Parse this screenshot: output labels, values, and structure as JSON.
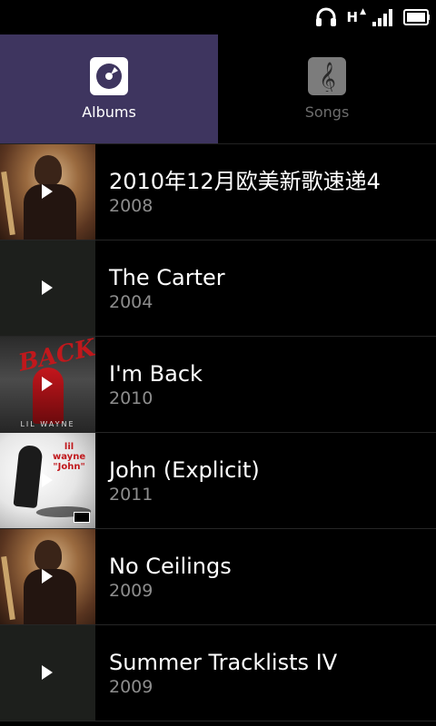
{
  "status_bar": {
    "network_type": "H",
    "icons": [
      "headphones-icon",
      "network-type-icon",
      "signal-icon",
      "battery-icon"
    ]
  },
  "tabs": [
    {
      "label": "Albums",
      "icon": "album-disc-icon",
      "active": true
    },
    {
      "label": "Songs",
      "icon": "music-note-icon",
      "active": false
    }
  ],
  "albums": [
    {
      "title": "2010年12月欧美新歌速递4",
      "year": "2008",
      "art": "weezy-cover"
    },
    {
      "title": "The Carter",
      "year": "2004",
      "art": "blank-cover"
    },
    {
      "title": "I'm Back",
      "year": "2010",
      "art": "im-back-cover"
    },
    {
      "title": "John (Explicit)",
      "year": "2011",
      "art": "john-cover"
    },
    {
      "title": "No Ceilings",
      "year": "2009",
      "art": "weezy-cover"
    },
    {
      "title": "Summer Tracklists IV",
      "year": "2009",
      "art": "blank-cover"
    }
  ],
  "colors": {
    "active_tab_bg": "#3e355f",
    "background": "#000000",
    "title_text": "#ffffff",
    "year_text": "#8d8d8d",
    "inactive_tab_text": "#6d6d6d"
  }
}
